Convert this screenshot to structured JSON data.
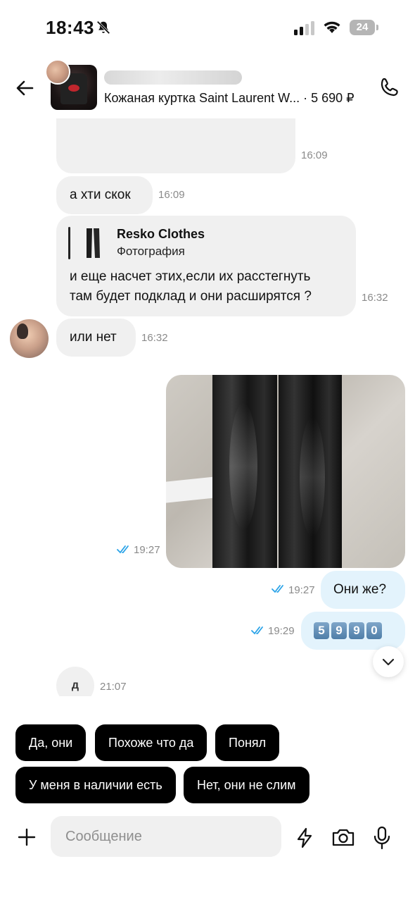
{
  "status_bar": {
    "time": "18:43",
    "battery": "24"
  },
  "header": {
    "subtitle": "Кожаная куртка Saint Laurent W... · 5 690 ₽"
  },
  "messages": [
    {
      "type": "incoming",
      "time": "16:09"
    },
    {
      "type": "incoming",
      "text": "а хти скок",
      "time": "16:09"
    },
    {
      "type": "incoming",
      "quote": {
        "title": "Resko Clothes",
        "subtitle": "Фотография"
      },
      "line1": "и еще насчет этих,если их расстегнуть",
      "line2": "там будет подклад и они расширятся ?",
      "time": "16:32"
    },
    {
      "type": "incoming",
      "text": "или нет",
      "time": "16:32"
    },
    {
      "type": "outgoing_photo",
      "time": "19:27"
    },
    {
      "type": "outgoing",
      "text": "Они же?",
      "time": "19:27"
    },
    {
      "type": "outgoing",
      "keycaps": [
        "5",
        "9",
        "9",
        "0"
      ],
      "time": "19:29"
    },
    {
      "type": "incoming",
      "text": "д",
      "time": "21:07"
    }
  ],
  "quick_replies": [
    "Да, они",
    "Похоже что да",
    "Понял",
    "У меня в наличии есть",
    "Нет, они не слим"
  ],
  "composer": {
    "placeholder": "Сообщение"
  },
  "colors": {
    "incoming_bubble": "#f0f0f0",
    "outgoing_bubble": "#e3f3fc",
    "read_check": "#2aa3e8",
    "quick_reply_bg": "#000000"
  }
}
